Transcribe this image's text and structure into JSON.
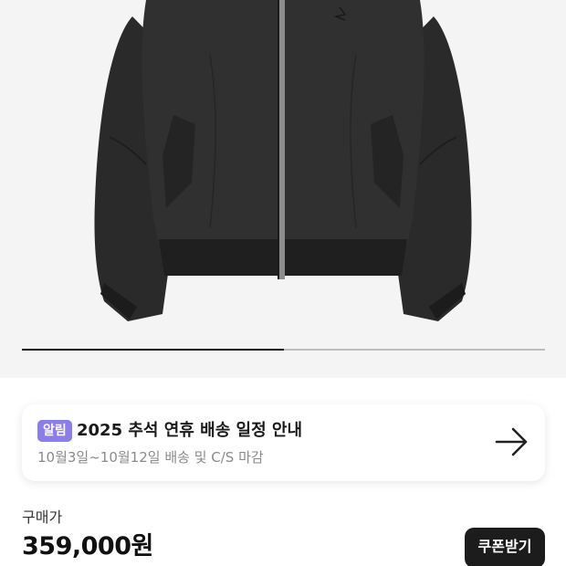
{
  "product": {
    "image_alt": "black zip-up bomber jacket",
    "gallery_progress": 0.5
  },
  "notice": {
    "badge": "알림",
    "title": "2025 추석 연휴 배송 일정 안내",
    "subtitle": "10월3일~10월12일 배송 및 C/S 마감",
    "icon": "arrow-right-icon"
  },
  "pricing": {
    "label": "구매가",
    "price": "359,000원",
    "coupon_button": "쿠폰받기"
  },
  "colors": {
    "hero_background": "#f4f4f4",
    "badge": "#8b7cf0",
    "button": "#1c1c1c"
  }
}
